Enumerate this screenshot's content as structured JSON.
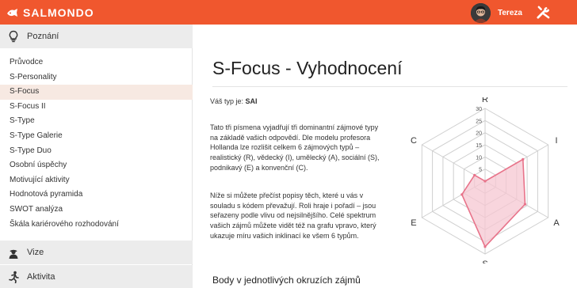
{
  "brand": {
    "name": "SALMONDO",
    "icon": "salmondo-logo-icon"
  },
  "user": {
    "name": "Tereza",
    "avatar": "user-avatar",
    "tools_icon": "tools-icon"
  },
  "sidebar": {
    "section_znalosti": {
      "label": "Poznání",
      "icon": "lightbulb-icon"
    },
    "items": [
      {
        "label": "Průvodce"
      },
      {
        "label": "S-Personality"
      },
      {
        "label": "S-Focus",
        "active": true
      },
      {
        "label": "S-Focus II"
      },
      {
        "label": "S-Type"
      },
      {
        "label": "S-Type Galerie"
      },
      {
        "label": "S-Type Duo"
      },
      {
        "label": "Osobní úspěchy"
      },
      {
        "label": "Motivující aktivity"
      },
      {
        "label": "Hodnotová pyramida"
      },
      {
        "label": "SWOT analýza"
      },
      {
        "label": "Škála kariérového rozhodování"
      }
    ],
    "section_vize": {
      "label": "Vize",
      "icon": "person-icon"
    },
    "section_aktivita": {
      "label": "Aktivita",
      "icon": "running-person-icon"
    }
  },
  "main": {
    "title": "S-Focus - Vyhodnocení",
    "type_prefix": "Váš typ je:",
    "type_value": "SAI",
    "paragraph1": "Tato tři písmena vyjadřují tři dominantní zájmové typy na základě vašich odpovědí. Dle modelu profesora Hollanda lze rozlišit celkem 6 zájmových typů – realistický (R), vědecký (I), umělecký (A), sociální (S), podnikavý (E) a konvenční (C).",
    "paragraph2": "Níže si můžete přečíst popisy těch, které u vás v souladu s kódem převažují. Roli hraje i pořadí – jsou seřazeny podle vlivu od nejsilnějšího. Celé spektrum vašich zájmů můžete vidět též na grafu vpravo, který ukazuje míru vašich inklinací ke všem 6 typům.",
    "subheading": "Body v jednotlivých okruzích zájmů"
  },
  "chart_data": {
    "type": "radar",
    "categories": [
      "R",
      "I",
      "A",
      "S",
      "E",
      "C"
    ],
    "series": [
      {
        "values": [
          0,
          18,
          19,
          27,
          11,
          5
        ],
        "color": "#e8738a",
        "fill": "#f6c7d1"
      }
    ],
    "scale": {
      "min": 0,
      "max": 30,
      "ticks": [
        5,
        10,
        15,
        20,
        25,
        30
      ]
    },
    "grid": true
  }
}
